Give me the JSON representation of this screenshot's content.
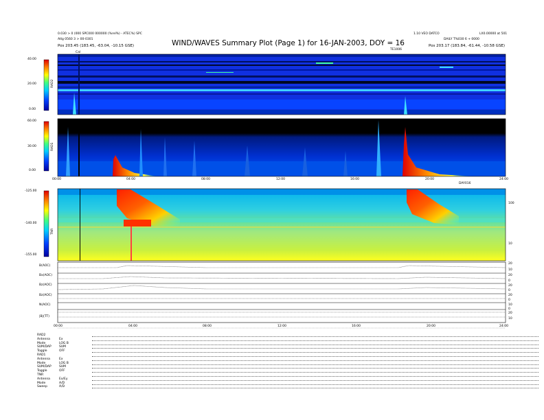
{
  "header": {
    "left_line1": "0.030 > 0 (000 SPC000 000000 (%rel%) - ATEC%) SPC",
    "left_line2": "Atlg 0560 3 > 00-0301",
    "left_pos": "Pos   203.45 (183.45, -63.04, -10.15 GSE)",
    "right_line1": "1.10 VEO DATCO",
    "right_line2": "DAILY  T%030 6 + 0000",
    "right_pos": "Pos   203.17 (183.84, -61.44, -10.58 GSE)",
    "right_corner": "LX0.00000 at 501",
    "title": "WIND/WAVES Summary Plot (Page 1) for 16-JAN-2003, DOY = 16",
    "cal_marker": "Cal",
    "mid_small": "TE1006"
  },
  "chart_data": [
    {
      "type": "heatmap",
      "panel": "RAD2",
      "ylabel": "RAD2",
      "yticks": [
        "40.00",
        "20.00",
        "0.00"
      ],
      "ylim": [
        0,
        40
      ],
      "colormap": "rainbow"
    },
    {
      "type": "heatmap",
      "panel": "RAD1",
      "ylabel": "RAD1",
      "yticks": [
        "60.00",
        "30.00",
        "0.00"
      ],
      "ylim": [
        0,
        60
      ],
      "colormap": "rainbow",
      "xticks": [
        "00:00",
        "04:00",
        "08:00",
        "12:00",
        "16:00",
        "20:00",
        "24:00"
      ],
      "x_corner_label": "DAY016"
    },
    {
      "type": "heatmap",
      "panel": "TNR",
      "ylabel": "TNR",
      "yticks": [
        "-125.00",
        "-140.00",
        "-155.00"
      ],
      "ylim": [
        -155,
        -125
      ],
      "right_ticks": [
        "100",
        "10"
      ],
      "colormap": "rainbow"
    },
    {
      "type": "line",
      "panel": "magnetometer",
      "rows": [
        {
          "label": "B(AOC)",
          "right": [
            "20",
            "10"
          ]
        },
        {
          "label": "Bx(AOC)",
          "right": [
            "20",
            "0"
          ]
        },
        {
          "label": "Bz(AOC)",
          "right": [
            "20",
            "0"
          ]
        },
        {
          "label": "Bz(AOC)",
          "right": [
            "20",
            "0"
          ]
        },
        {
          "label": "N(AOC)",
          "right": [
            "10",
            "0"
          ]
        },
        {
          "label": "|B|(TT)",
          "right": [
            "20",
            "10"
          ]
        }
      ],
      "xticks": [
        "00:00",
        "04:00",
        "08:00",
        "12:00",
        "16:00",
        "20:00",
        "24:00"
      ]
    }
  ],
  "status": [
    {
      "label": "RAD2",
      "value": ""
    },
    {
      "label": "Antenna",
      "value": "Ex"
    },
    {
      "label": "Mode",
      "value": "LOG B"
    },
    {
      "label": "SUM/DAP",
      "value": "SUM"
    },
    {
      "label": "Toggle",
      "value": "OFF"
    },
    {
      "label": "RAD1",
      "value": ""
    },
    {
      "label": "Antenna",
      "value": "Ex"
    },
    {
      "label": "Mode",
      "value": "LOG B"
    },
    {
      "label": "SUM/DAP",
      "value": "SUM"
    },
    {
      "label": "Toggle",
      "value": "OFF"
    },
    {
      "label": "TNR",
      "value": ""
    },
    {
      "label": "Antenna",
      "value": "Ex/Ey"
    },
    {
      "label": "Mode",
      "value": "A/D"
    },
    {
      "label": "Sweep",
      "value": "A/D"
    }
  ]
}
